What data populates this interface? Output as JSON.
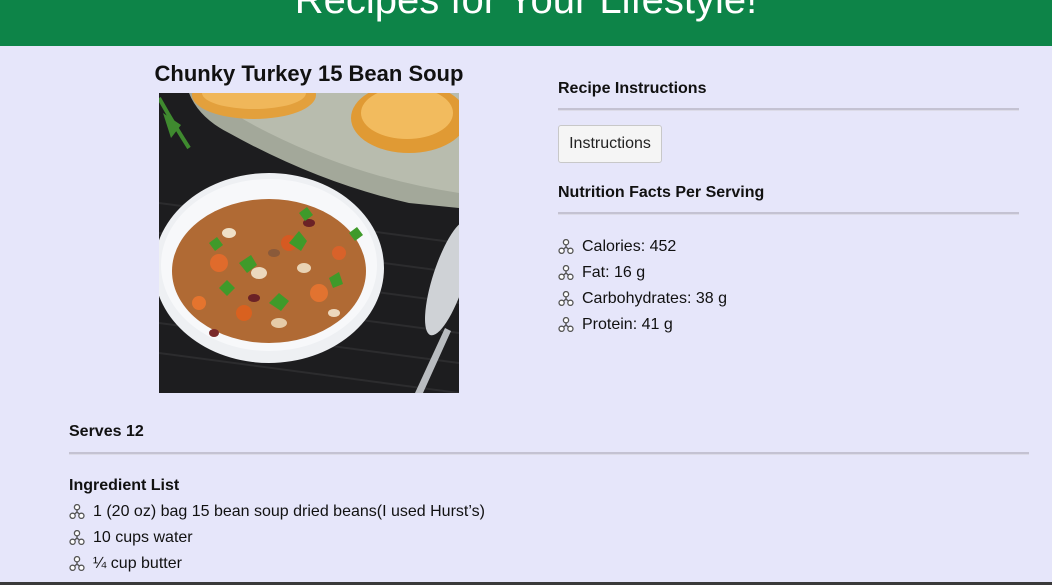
{
  "header": {
    "title": "Recipes for Your Lifestyle!"
  },
  "recipe": {
    "title": "Chunky Turkey 15 Bean Soup",
    "serves": "Serves 12"
  },
  "instructions_section": {
    "heading": "Recipe Instructions",
    "button_label": "Instructions"
  },
  "nutrition": {
    "heading": "Nutrition Facts Per Serving",
    "items": [
      "Calories: 452",
      "Fat: 16 g",
      "Carbohydrates: 38 g",
      "Protein: 41 g"
    ]
  },
  "ingredients": {
    "heading": "Ingredient List",
    "items": [
      "1 (20 oz) bag 15 bean soup dried beans(I used Hurst’s)",
      "10 cups water",
      "¼ cup butter"
    ]
  },
  "icons": {
    "bullet": "triskelion-bullet-icon"
  },
  "colors": {
    "banner": "#0d8448",
    "page_background": "#e6e6fa"
  }
}
